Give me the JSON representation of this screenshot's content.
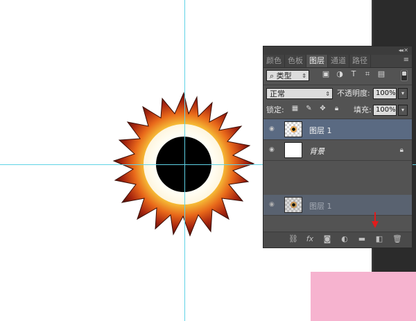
{
  "panel": {
    "tabs": [
      "颜色",
      "色板",
      "图层",
      "通道",
      "路径"
    ],
    "active_tab": "图层",
    "filter": {
      "kind_label": "类型"
    },
    "blend_mode": "正常",
    "opacity_label": "不透明度:",
    "opacity_value": "100%",
    "lock_label": "锁定:",
    "fill_label": "填充:",
    "fill_value": "100%",
    "layers": [
      {
        "name": "图层 1",
        "selected": true
      },
      {
        "name": "背景",
        "locked": true
      },
      {
        "name": "图层 1",
        "dragging": true
      }
    ]
  },
  "colors": {
    "guide": "#5fd3e6",
    "panel_bg": "#535353",
    "selected_layer": "#5a6a82",
    "arrow": "#e21b1b",
    "pink_block": "#f6b3cf"
  },
  "icons": {
    "filter": [
      "image-filter-icon",
      "adjustment-filter-icon",
      "type-filter-icon",
      "shape-filter-icon",
      "smartobject-filter-icon"
    ],
    "lock": [
      "lock-transparent-icon",
      "lock-paint-icon",
      "lock-move-icon",
      "lock-all-icon"
    ],
    "bottom": [
      "link-icon",
      "fx-icon",
      "mask-icon",
      "adjustment-icon",
      "folder-icon",
      "new-layer-icon",
      "trash-icon"
    ]
  }
}
